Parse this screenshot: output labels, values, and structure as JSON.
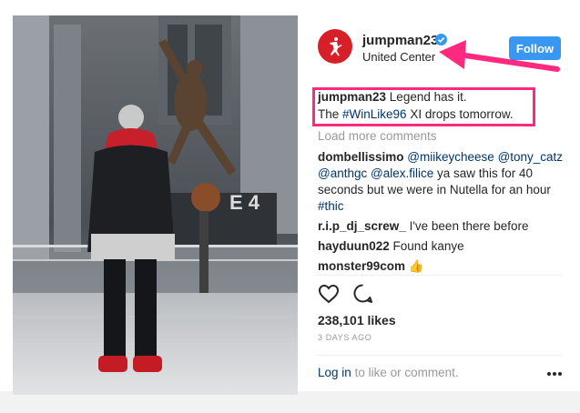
{
  "post": {
    "username": "jumpman23",
    "location": "United Center",
    "follow_label": "Follow",
    "caption": {
      "user": "jumpman23",
      "line1": "Legend has it.",
      "line2_prefix": "The",
      "hashtag": "#WinLike96",
      "line2_suffix": "XI drops tomorrow."
    },
    "load_more": "Load more comments",
    "comments": [
      {
        "user": "dombellissimo",
        "mention1": "@miikeycheese",
        "mention2": "@tony_catz",
        "mention3": "@anthgc",
        "mention4": "@alex.filice",
        "text1": "ya saw this for 40",
        "text2": "seconds but we were in Nutella for an hour",
        "hashtag": "#thic"
      },
      {
        "user": "r.i.p_dj_screw_",
        "text": "I've been there before"
      },
      {
        "user": "hayduun022",
        "text": "Found kanye"
      },
      {
        "user": "monster99com",
        "emoji": "👍"
      }
    ],
    "likes": "238,101 likes",
    "date": "3 DAYS AGO",
    "login_link": "Log in",
    "login_text": "to like or comment.",
    "colors": {
      "accent": "#3897f0",
      "highlight": "#ff2a7f",
      "brand": "#d71f2a"
    },
    "icons": [
      "jumpman-logo-icon",
      "verified-badge-icon",
      "heart-icon",
      "comment-icon",
      "more-options-icon"
    ]
  }
}
